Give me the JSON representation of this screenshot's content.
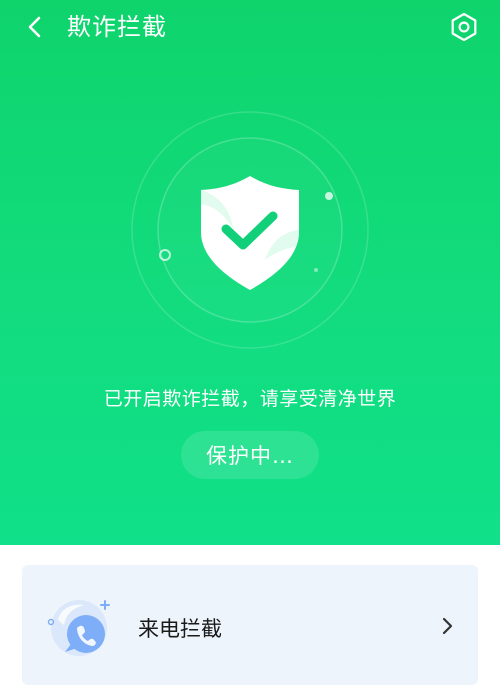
{
  "header": {
    "back_icon": "chevron-left-icon",
    "title": "欺诈拦截",
    "settings_icon": "settings-hexagon-icon"
  },
  "hero": {
    "shield_icon": "shield-check-icon",
    "slogan": "已开启欺诈拦截，请享受清净世界",
    "status_label": "保护中…"
  },
  "features": {
    "items": [
      {
        "label": "来电拦截",
        "icon": "incoming-call-bubble-icon",
        "chevron_icon": "chevron-right-icon"
      }
    ]
  },
  "colors": {
    "primary_green": "#12dc7e",
    "card_background": "#eef4fc",
    "icon_blue": "#7eaef7"
  }
}
